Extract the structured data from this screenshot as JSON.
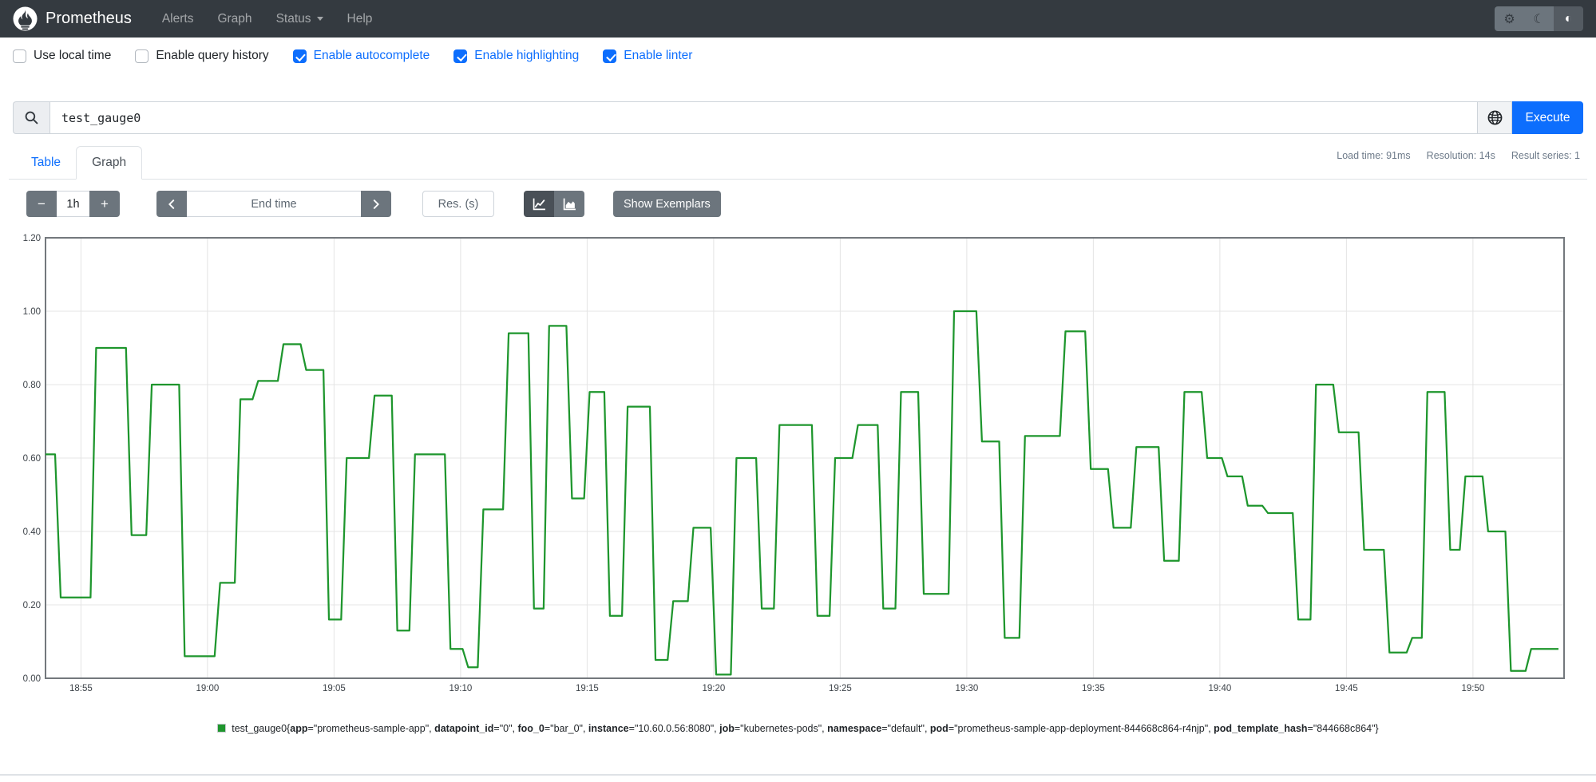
{
  "navbar": {
    "brand": "Prometheus",
    "links": [
      {
        "label": "Alerts"
      },
      {
        "label": "Graph"
      },
      {
        "label": "Status",
        "caret": true
      },
      {
        "label": "Help"
      }
    ]
  },
  "theme_toggle": {
    "icons": [
      "sun-icon",
      "moon-icon",
      "auto-contrast-icon"
    ],
    "active_index": 2
  },
  "options": [
    {
      "label": "Use local time",
      "checked": false
    },
    {
      "label": "Enable query history",
      "checked": false
    },
    {
      "label": "Enable autocomplete",
      "checked": true
    },
    {
      "label": "Enable highlighting",
      "checked": true
    },
    {
      "label": "Enable linter",
      "checked": true
    }
  ],
  "query": {
    "value": "test_gauge0",
    "execute_label": "Execute"
  },
  "stats": {
    "load_time": "Load time: 91ms",
    "resolution": "Resolution: 14s",
    "result_series": "Result series: 1"
  },
  "tabs": [
    {
      "label": "Table",
      "active": false
    },
    {
      "label": "Graph",
      "active": true
    }
  ],
  "controls": {
    "minus": "−",
    "range": "1h",
    "plus": "+",
    "end_time_placeholder": "End time",
    "res_placeholder": "Res. (s)",
    "show_exemplars": "Show Exemplars"
  },
  "legend": {
    "metric": "test_gauge0",
    "labels": [
      {
        "k": "app",
        "v": "prometheus-sample-app"
      },
      {
        "k": "datapoint_id",
        "v": "0"
      },
      {
        "k": "foo_0",
        "v": "bar_0"
      },
      {
        "k": "instance",
        "v": "10.60.0.56:8080"
      },
      {
        "k": "job",
        "v": "kubernetes-pods"
      },
      {
        "k": "namespace",
        "v": "default"
      },
      {
        "k": "pod",
        "v": "prometheus-sample-app-deployment-844668c864-r4njp"
      },
      {
        "k": "pod_template_hash",
        "v": "844668c864"
      }
    ]
  },
  "chart_data": {
    "type": "line",
    "step_interpolation": true,
    "title": "",
    "xlabel": "",
    "ylabel": "",
    "ylim": [
      0,
      1.2
    ],
    "grid": true,
    "legend_position": "bottom",
    "y_ticks": [
      {
        "label": "0.00",
        "v": 0.0
      },
      {
        "label": "0.20",
        "v": 0.2
      },
      {
        "label": "0.40",
        "v": 0.4
      },
      {
        "label": "0.60",
        "v": 0.6
      },
      {
        "label": "0.80",
        "v": 0.8
      },
      {
        "label": "1.00",
        "v": 1.0
      },
      {
        "label": "1.20",
        "v": 1.2
      }
    ],
    "x_window_minutes": 60,
    "x_end": 60,
    "x_ticks": [
      {
        "label": "18:55",
        "t": 1.4
      },
      {
        "label": "19:00",
        "t": 6.4
      },
      {
        "label": "19:05",
        "t": 11.4
      },
      {
        "label": "19:10",
        "t": 16.4
      },
      {
        "label": "19:15",
        "t": 21.4
      },
      {
        "label": "19:20",
        "t": 26.4
      },
      {
        "label": "19:25",
        "t": 31.4
      },
      {
        "label": "19:30",
        "t": 36.4
      },
      {
        "label": "19:35",
        "t": 41.4
      },
      {
        "label": "19:40",
        "t": 46.4
      },
      {
        "label": "19:45",
        "t": 51.4
      },
      {
        "label": "19:50",
        "t": 56.4
      }
    ],
    "series": [
      {
        "name": "test_gauge0",
        "color": "#1e962d",
        "points": [
          [
            0.0,
            0.61
          ],
          [
            0.6,
            0.22
          ],
          [
            2.0,
            0.9
          ],
          [
            3.4,
            0.39
          ],
          [
            4.2,
            0.8
          ],
          [
            5.5,
            0.06
          ],
          [
            6.9,
            0.26
          ],
          [
            7.7,
            0.76
          ],
          [
            8.4,
            0.81
          ],
          [
            9.4,
            0.91
          ],
          [
            10.3,
            0.84
          ],
          [
            11.2,
            0.16
          ],
          [
            11.9,
            0.6
          ],
          [
            13.0,
            0.77
          ],
          [
            13.9,
            0.13
          ],
          [
            14.6,
            0.61
          ],
          [
            16.0,
            0.08
          ],
          [
            16.7,
            0.03
          ],
          [
            17.3,
            0.46
          ],
          [
            18.3,
            0.94
          ],
          [
            19.3,
            0.19
          ],
          [
            19.9,
            0.96
          ],
          [
            20.8,
            0.49
          ],
          [
            21.5,
            0.78
          ],
          [
            22.3,
            0.17
          ],
          [
            23.0,
            0.74
          ],
          [
            24.1,
            0.05
          ],
          [
            24.8,
            0.21
          ],
          [
            25.6,
            0.41
          ],
          [
            26.5,
            0.01
          ],
          [
            27.3,
            0.6
          ],
          [
            28.3,
            0.19
          ],
          [
            29.0,
            0.69
          ],
          [
            30.5,
            0.17
          ],
          [
            31.2,
            0.6
          ],
          [
            32.1,
            0.69
          ],
          [
            33.1,
            0.19
          ],
          [
            33.8,
            0.78
          ],
          [
            34.7,
            0.23
          ],
          [
            35.9,
            1.0
          ],
          [
            37.0,
            0.645
          ],
          [
            37.9,
            0.11
          ],
          [
            38.7,
            0.66
          ],
          [
            40.3,
            0.945
          ],
          [
            41.3,
            0.57
          ],
          [
            42.2,
            0.41
          ],
          [
            43.1,
            0.63
          ],
          [
            44.2,
            0.32
          ],
          [
            45.0,
            0.78
          ],
          [
            45.9,
            0.6
          ],
          [
            46.7,
            0.55
          ],
          [
            47.5,
            0.47
          ],
          [
            48.3,
            0.45
          ],
          [
            49.5,
            0.16
          ],
          [
            50.2,
            0.8
          ],
          [
            51.1,
            0.67
          ],
          [
            52.1,
            0.35
          ],
          [
            53.1,
            0.07
          ],
          [
            54.0,
            0.11
          ],
          [
            54.6,
            0.78
          ],
          [
            55.5,
            0.35
          ],
          [
            56.1,
            0.55
          ],
          [
            57.0,
            0.4
          ],
          [
            57.9,
            0.02
          ],
          [
            58.7,
            0.08
          ]
        ]
      }
    ]
  },
  "theme": {
    "accent": "#0d6efd",
    "navbar_bg": "#343a40",
    "series_green": "#1e962d",
    "button_gray": "#6c757d"
  }
}
